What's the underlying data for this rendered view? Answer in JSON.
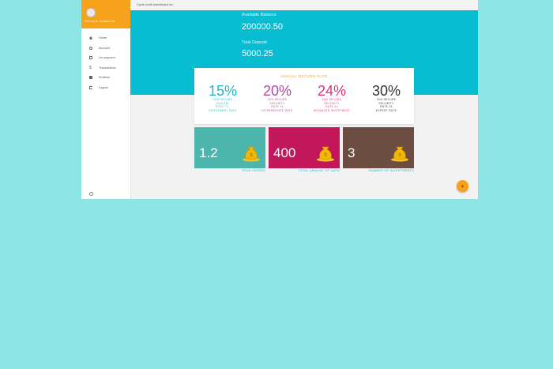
{
  "topbar": {
    "title": "Cycle moth dashboard inc"
  },
  "sidebar": {
    "user_name": "Brenna A. Gustam ex.",
    "items": [
      {
        "label": "Home",
        "icon": "home-icon"
      },
      {
        "label": "Account",
        "icon": "person-icon"
      },
      {
        "label": "Lin payment",
        "icon": "calendar-icon"
      },
      {
        "label": "Transactions",
        "icon": "money-icon"
      },
      {
        "label": "Portfolio",
        "icon": "grid-icon"
      },
      {
        "label": "Logout",
        "icon": "logout-icon"
      }
    ],
    "bottom_icon": "settings-icon"
  },
  "balance": {
    "available_label": "Available Balance",
    "available_value": "200000.50",
    "deposit_label": "Total Deposit",
    "deposit_value": "5000.25"
  },
  "rates": {
    "title": "ANNUAL RETURN RATE",
    "items": [
      {
        "pct": "15%",
        "color": "#1fb6c8",
        "lines": [
          "20% SECURE",
          "10 ALTEL",
          "NTEC 7 L",
          "INVESTMENT RATE"
        ]
      },
      {
        "pct": "20%",
        "color": "#b04aa0",
        "lines": [
          "20% SECURE",
          "SECURITY",
          "RATE 15",
          "INTERMEDIATE RATE"
        ]
      },
      {
        "pct": "24%",
        "color": "#e0317a",
        "lines": [
          "15% SECURE",
          "SECURITY",
          "RATE 20",
          "ADVANCED INVESTMENT"
        ]
      },
      {
        "pct": "30%",
        "color": "#333333",
        "lines": [
          "20% SECURE",
          "SECURITY",
          "RATE 25",
          "EXPERT RATE"
        ]
      }
    ]
  },
  "tiles": [
    {
      "value": "1.2",
      "label": "YEAR PASSED",
      "bg": "#4db6ac",
      "label_color": "#1fb6c8"
    },
    {
      "value": "400",
      "label": "TOTAL AMOUNT OF DAYS",
      "bg": "#c2185b",
      "label_color": "#1fb6c8"
    },
    {
      "value": "3",
      "label": "NUMBER OF INVESTMENTS",
      "bg": "#6d4c41",
      "label_color": "#1fb6c8"
    }
  ],
  "fab": {
    "icon": "plus-icon"
  }
}
